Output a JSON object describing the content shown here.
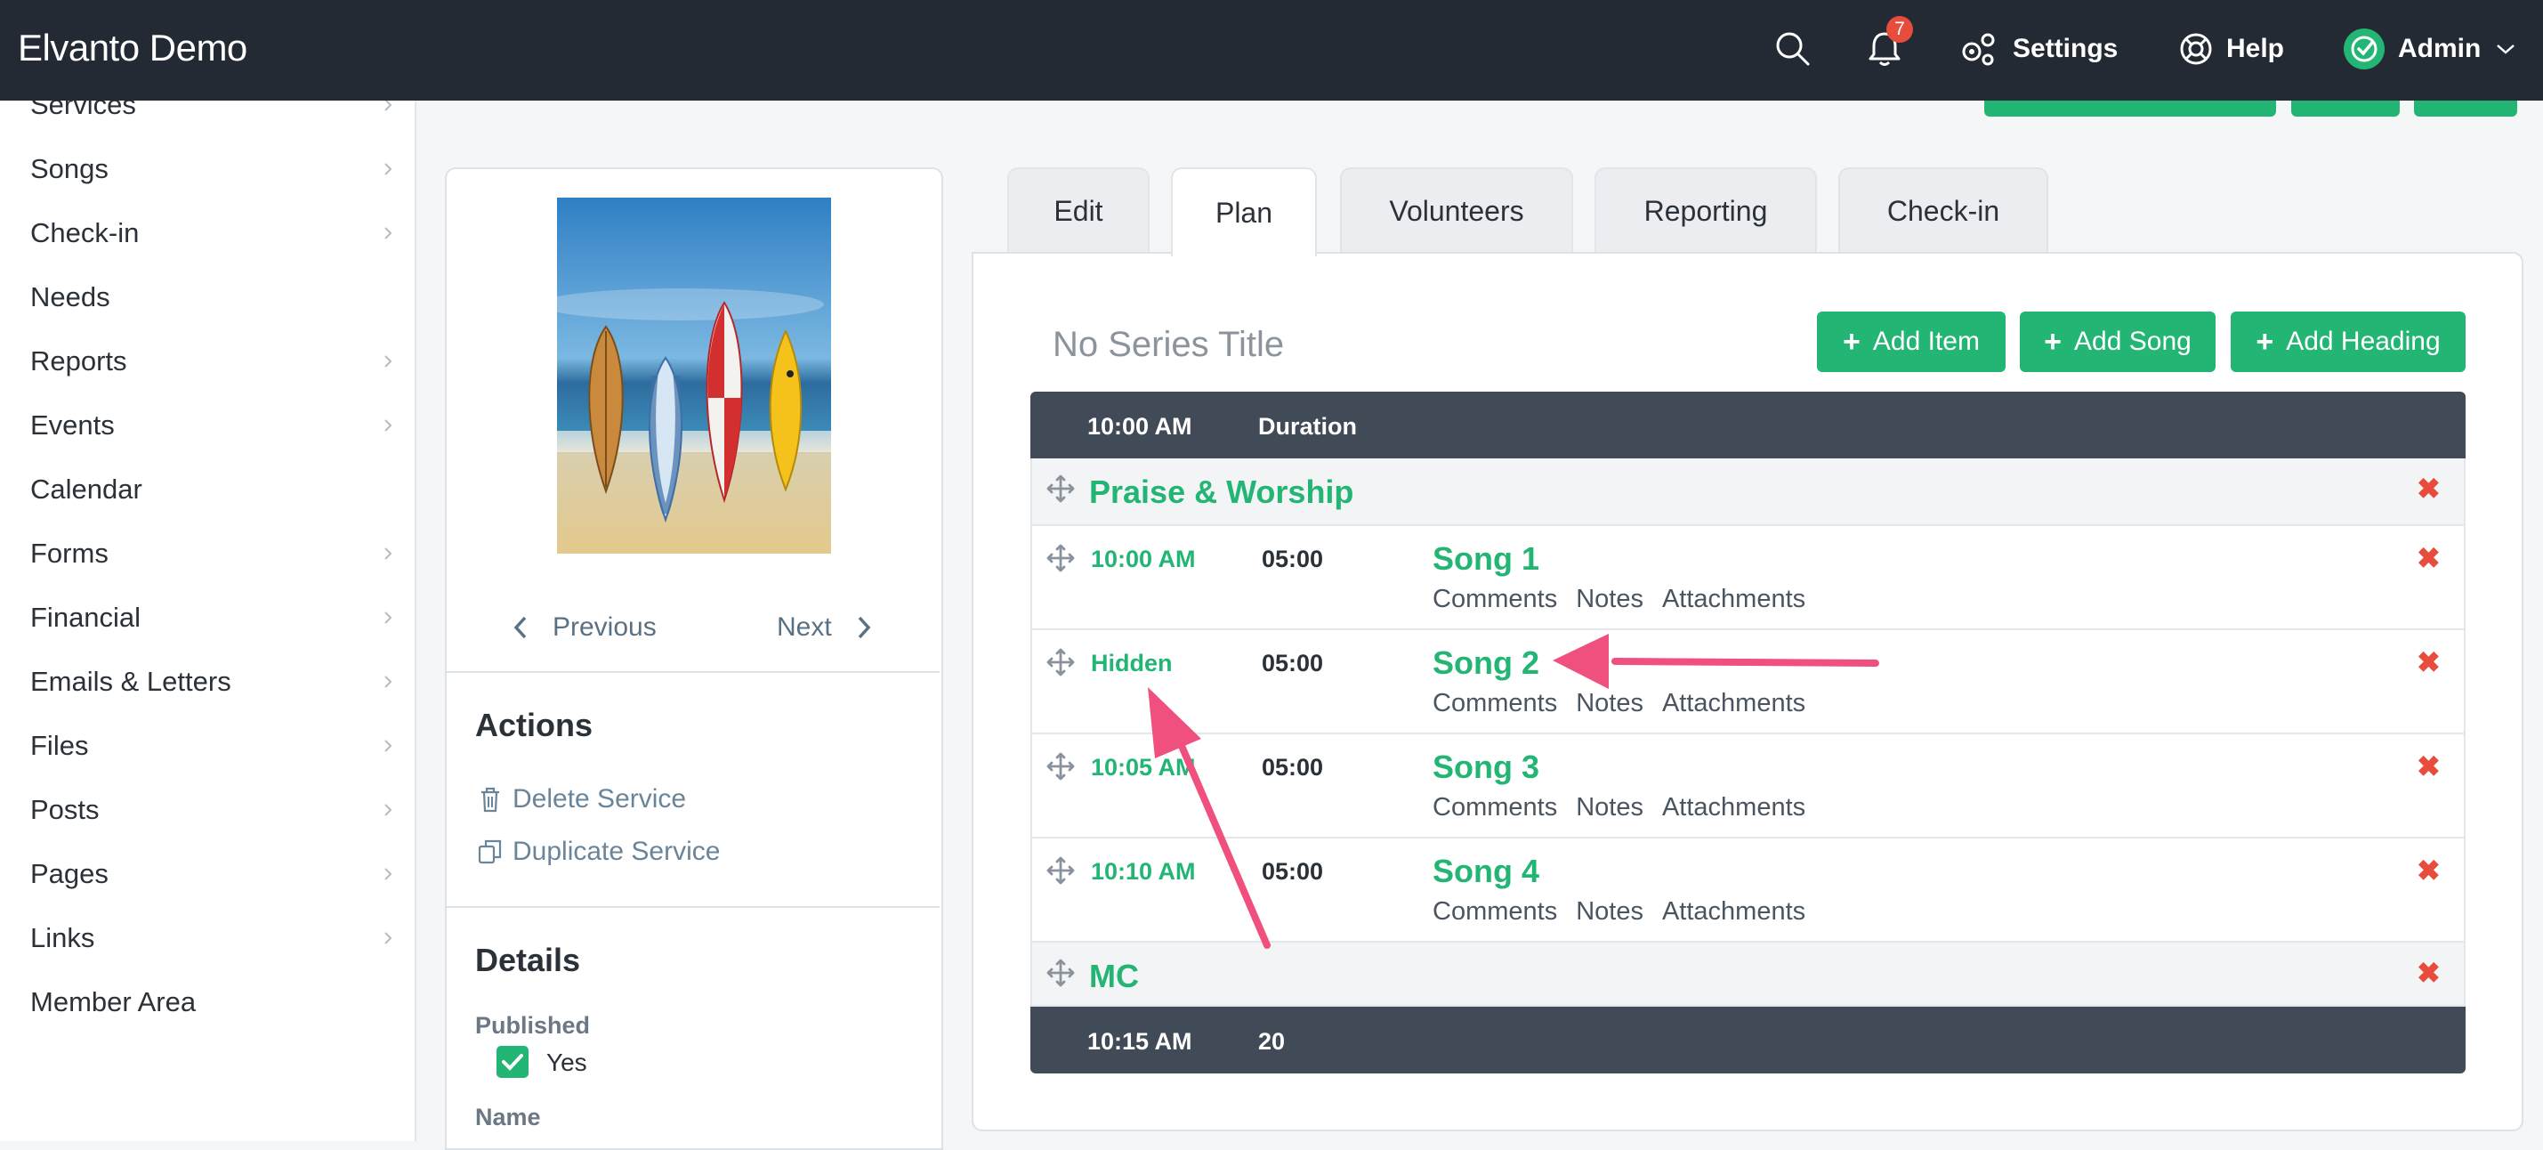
{
  "app": {
    "title": "Elvanto Demo"
  },
  "topbar": {
    "notifications_count": "7",
    "settings_label": "Settings",
    "help_label": "Help",
    "admin_label": "Admin"
  },
  "sidebar": {
    "items": [
      {
        "label": "Services",
        "chevron": true
      },
      {
        "label": "Songs",
        "chevron": true
      },
      {
        "label": "Check-in",
        "chevron": true
      },
      {
        "label": "Needs",
        "chevron": false
      },
      {
        "label": "Reports",
        "chevron": true
      },
      {
        "label": "Events",
        "chevron": true
      },
      {
        "label": "Calendar",
        "chevron": false
      },
      {
        "label": "Forms",
        "chevron": true
      },
      {
        "label": "Financial",
        "chevron": true
      },
      {
        "label": "Emails & Letters",
        "chevron": true
      },
      {
        "label": "Files",
        "chevron": true
      },
      {
        "label": "Posts",
        "chevron": true
      },
      {
        "label": "Pages",
        "chevron": true
      },
      {
        "label": "Links",
        "chevron": true
      },
      {
        "label": "Member Area",
        "chevron": false
      }
    ]
  },
  "service_panel": {
    "previous_label": "Previous",
    "next_label": "Next",
    "actions_heading": "Actions",
    "delete_label": "Delete Service",
    "duplicate_label": "Duplicate Service",
    "details_heading": "Details",
    "published_label": "Published",
    "published_value": "Yes",
    "name_label": "Name"
  },
  "tabs": [
    {
      "label": "Edit",
      "active": false
    },
    {
      "label": "Plan",
      "active": true
    },
    {
      "label": "Volunteers",
      "active": false
    },
    {
      "label": "Reporting",
      "active": false
    },
    {
      "label": "Check-in",
      "active": false
    }
  ],
  "plan": {
    "series_title": "No Series Title",
    "buttons": {
      "add_item": "Add Item",
      "add_song": "Add Song",
      "add_heading": "Add Heading"
    },
    "header": {
      "time": "10:00 AM",
      "duration_label": "Duration"
    },
    "heading1": "Praise & Worship",
    "rows": [
      {
        "time": "10:00 AM",
        "duration": "05:00",
        "title": "Song 1",
        "comments": "Comments",
        "notes": "Notes",
        "attachments": "Attachments"
      },
      {
        "time": "Hidden",
        "duration": "05:00",
        "title": "Song 2",
        "comments": "Comments",
        "notes": "Notes",
        "attachments": "Attachments"
      },
      {
        "time": "10:05 AM",
        "duration": "05:00",
        "title": "Song 3",
        "comments": "Comments",
        "notes": "Notes",
        "attachments": "Attachments"
      },
      {
        "time": "10:10 AM",
        "duration": "05:00",
        "title": "Song 4",
        "comments": "Comments",
        "notes": "Notes",
        "attachments": "Attachments"
      }
    ],
    "heading2": "MC",
    "footer": {
      "time": "10:15 AM",
      "duration": "20"
    }
  },
  "colors": {
    "topbar": "#232a33",
    "accent_green": "#23b574",
    "delete_red": "#e74c3c",
    "annotation_arrow": "#f0507e",
    "table_header": "#414a57"
  },
  "icons": [
    "search-icon",
    "bell-icon",
    "gear-icon",
    "lifebuoy-icon",
    "check-circle-icon",
    "chevron-down-icon",
    "chevron-right-icon",
    "chevron-left-icon",
    "trash-icon",
    "duplicate-icon",
    "drag-handle-icon",
    "close-icon",
    "plus-icon"
  ]
}
